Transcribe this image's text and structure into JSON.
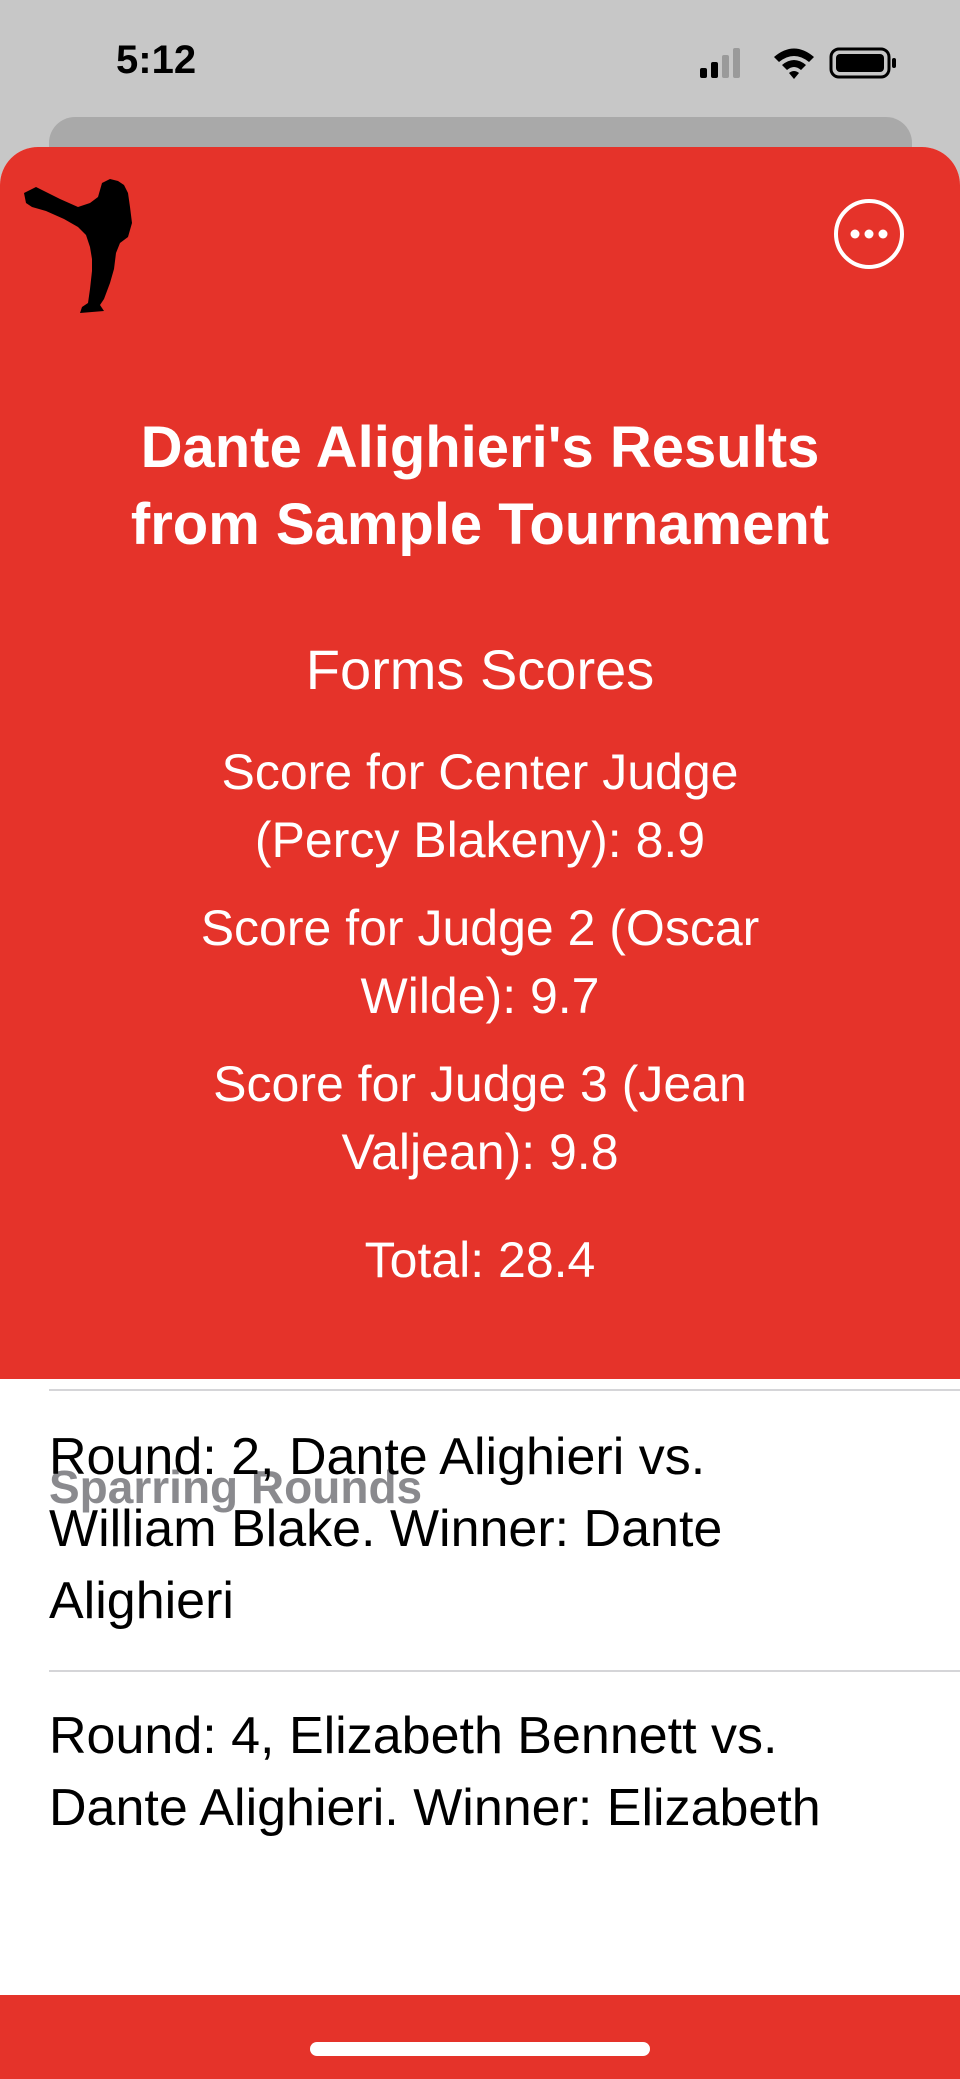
{
  "status": {
    "time": "5:12"
  },
  "header": {
    "title_line1": "Dante Alighieri's Results",
    "title_line2": "from Sample Tournament",
    "more_icon": "ellipsis-circle-icon",
    "logo_icon": "martial-artist-kick-icon"
  },
  "forms": {
    "heading": "Forms Scores",
    "scores": [
      {
        "line1": "Score for Center Judge",
        "line2": "(Percy Blakeny): 8.9"
      },
      {
        "line1": "Score for Judge 2 (Oscar",
        "line2": "Wilde): 9.7"
      },
      {
        "line1": "Score for Judge 3 (Jean",
        "line2": "Valjean): 9.8"
      }
    ],
    "total": "Total: 28.4"
  },
  "sparring": {
    "heading": "Sparring Rounds",
    "rounds": [
      {
        "lines": [
          "Round: 2, Dante Alighieri vs.",
          "William Blake. Winner: Dante",
          "Alighieri"
        ]
      },
      {
        "lines": [
          "Round: 4, Elizabeth Bennett vs.",
          "Dante Alighieri. Winner: Elizabeth"
        ]
      }
    ]
  },
  "colors": {
    "accent": "#e5332a",
    "section_header": "#8a8a8e"
  }
}
